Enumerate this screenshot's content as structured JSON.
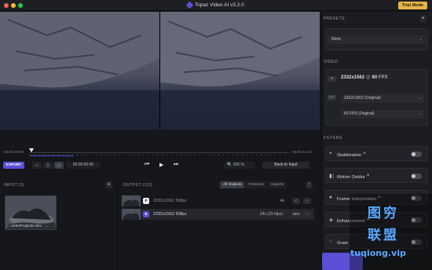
{
  "titlebar": {
    "title": "Topaz Video AI  v3.2.0",
    "trial_label": "Trial Mode"
  },
  "timeline": {
    "start_time": "00:00:00:00",
    "end_time": "00:00:14:01",
    "export_label": "EXPORT",
    "current_time": "00:00:00:00",
    "zoom_value": "100",
    "zoom_unit": "%",
    "back_label": "Back to Input"
  },
  "input": {
    "header": "INPUT (1)",
    "file_name": "...orderProject5.mkv",
    "file_more": "..."
  },
  "output": {
    "header": "OUTPUT (1/2)",
    "tabs": [
      "All Outputs",
      "Previews",
      "Exports"
    ],
    "rows": [
      {
        "badge": "P",
        "text": "2332x1562  60fps",
        "duration": "4s",
        "chip1": "✓",
        "chip2": "···"
      },
      {
        "badge": "E",
        "text": "2332x1562  60fps",
        "duration": "24s (29.0fps)",
        "chip1": "16%",
        "chip2": "···"
      }
    ]
  },
  "sidebar": {
    "presets_header": "PRESETS",
    "preset_value": "None",
    "video_header": "VIDEO",
    "in_tag": "IN",
    "in_res": "2332x1562",
    "in_at": "@",
    "in_fps": "60",
    "in_fps_unit": "FPS",
    "out_tag": "OUT",
    "out_res_option": "2332x1562 (Original)",
    "out_fps_option": "60 FPS (Original)",
    "filters_header": "FILTERS",
    "filters": [
      {
        "label": "Stabilization",
        "sup": "AI"
      },
      {
        "label": "Motion Deblur",
        "sup": "AI"
      },
      {
        "label": "Frame Interpolation",
        "sup": "AI"
      },
      {
        "label": "Enhancement",
        "sup": "AI"
      },
      {
        "label": "Grain",
        "sup": ""
      }
    ]
  },
  "watermark": {
    "chars": "图穷",
    "chars2": "联盟",
    "url": "tuqiong.vip"
  },
  "colors": {
    "accent": "#5a4fd6",
    "trial": "#e6b34a",
    "watermark": "#5aa8ff"
  }
}
